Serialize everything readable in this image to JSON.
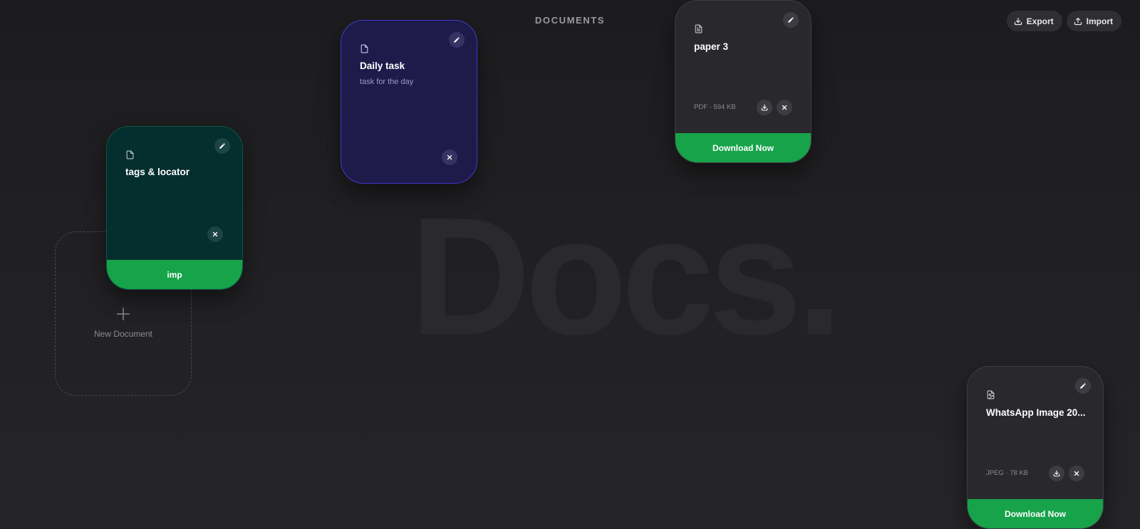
{
  "background_word": "Docs.",
  "header": {
    "title": "DOCUMENTS"
  },
  "toolbar": {
    "export_label": "Export",
    "import_label": "Import"
  },
  "new_document": {
    "label": "New Document"
  },
  "cards": {
    "tags": {
      "title": "tags & locator",
      "tag_label": "imp",
      "color": "#052e2e",
      "icon": "file-icon"
    },
    "daily": {
      "title": "Daily task",
      "subtitle": "task for the day",
      "color": "#1e1b4b",
      "icon": "file-icon"
    },
    "paper": {
      "title": "paper 3",
      "meta": "PDF · 594 KB",
      "action_label": "Download Now",
      "icon": "file-text-icon"
    },
    "whatsapp": {
      "title": "WhatsApp Image 20...",
      "meta": "JPEG · 78 KB",
      "action_label": "Download Now",
      "icon": "file-image-icon"
    }
  },
  "colors": {
    "accent_green": "#16a34a",
    "background": "#1f1f22"
  }
}
